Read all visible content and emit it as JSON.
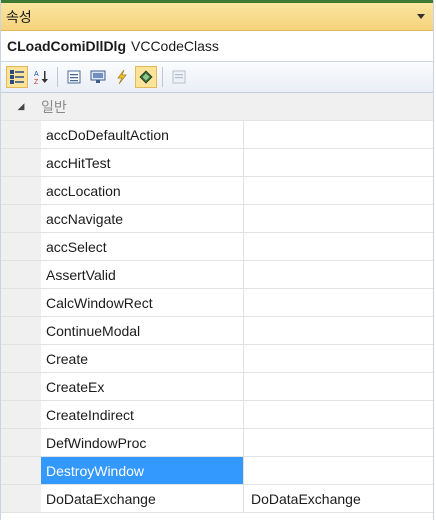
{
  "panel": {
    "title": "속성",
    "object_name": "CLoadComiDllDlg",
    "object_type": "VCCodeClass"
  },
  "toolbar": {
    "buttons": [
      {
        "icon": "categorized-icon",
        "active": true
      },
      {
        "icon": "alphabetical-icon",
        "active": false
      },
      {
        "icon": "properties-icon",
        "active": false
      },
      {
        "icon": "messages-icon",
        "active": false
      },
      {
        "icon": "events-icon",
        "active": false
      },
      {
        "icon": "overrides-icon",
        "active": true
      },
      {
        "icon": "property-pages-icon",
        "active": false
      }
    ]
  },
  "grid": {
    "category": "일반",
    "rows": [
      {
        "name": "accDoDefaultAction",
        "value": ""
      },
      {
        "name": "accHitTest",
        "value": ""
      },
      {
        "name": "accLocation",
        "value": ""
      },
      {
        "name": "accNavigate",
        "value": ""
      },
      {
        "name": "accSelect",
        "value": ""
      },
      {
        "name": "AssertValid",
        "value": ""
      },
      {
        "name": "CalcWindowRect",
        "value": ""
      },
      {
        "name": "ContinueModal",
        "value": ""
      },
      {
        "name": "Create",
        "value": ""
      },
      {
        "name": "CreateEx",
        "value": ""
      },
      {
        "name": "CreateIndirect",
        "value": ""
      },
      {
        "name": "DefWindowProc",
        "value": ""
      },
      {
        "name": "DestroyWindow",
        "value": "",
        "selected": true
      },
      {
        "name": "DoDataExchange",
        "value": "DoDataExchange"
      }
    ]
  },
  "colors": {
    "title_bar": "#f5d37c",
    "selection": "#3399ff",
    "category_text": "#8a8a8a",
    "accent_green": "#3d7a34"
  }
}
